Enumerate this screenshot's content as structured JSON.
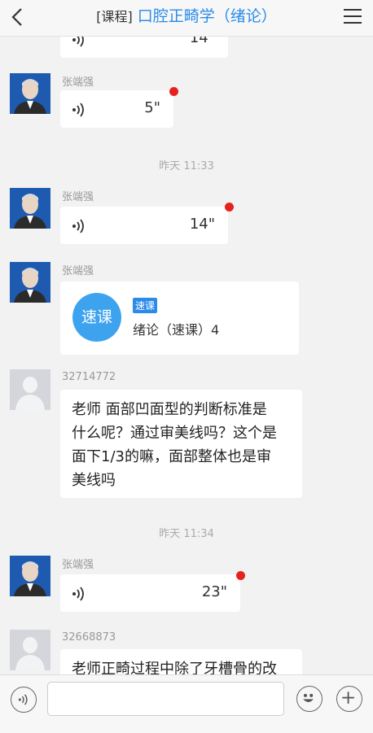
{
  "header": {
    "title_prefix": "[课程]",
    "course_name": "口腔正畸学（绪论）"
  },
  "messages": [
    {
      "type": "voice",
      "duration": "14\""
    },
    {
      "type": "voice",
      "sender": "张端强",
      "duration": "5\""
    },
    {
      "type": "timestamp",
      "text": "昨天 11:33"
    },
    {
      "type": "voice",
      "sender": "张端强",
      "duration": "14\""
    },
    {
      "type": "course",
      "sender": "张端强",
      "icon_text": "速课",
      "tag": "速课",
      "name": "绪论（速课）4"
    },
    {
      "type": "text",
      "sender": "32714772",
      "lines": [
        "老师 面部凹面型的判断标准是",
        "什么呢？通过审美线吗？这个是",
        "面下1/3的嘛，面部整体也是审",
        "美线吗"
      ]
    },
    {
      "type": "timestamp",
      "text": "昨天 11:34"
    },
    {
      "type": "voice",
      "sender": "张端强",
      "duration": "23\""
    },
    {
      "type": "text",
      "sender": "32668873",
      "lines": [
        "老师正畸过程中除了牙槽骨的改"
      ]
    }
  ],
  "input": {
    "placeholder": ""
  },
  "icons": {
    "back": "back-arrow-icon",
    "menu": "hamburger-menu-icon",
    "voice_toggle": "voice-icon",
    "emoji": "emoji-icon",
    "add": "plus-icon"
  },
  "colors": {
    "accent": "#2a8be8",
    "unread": "#e5221e",
    "course_icon": "#3ea3ee"
  }
}
